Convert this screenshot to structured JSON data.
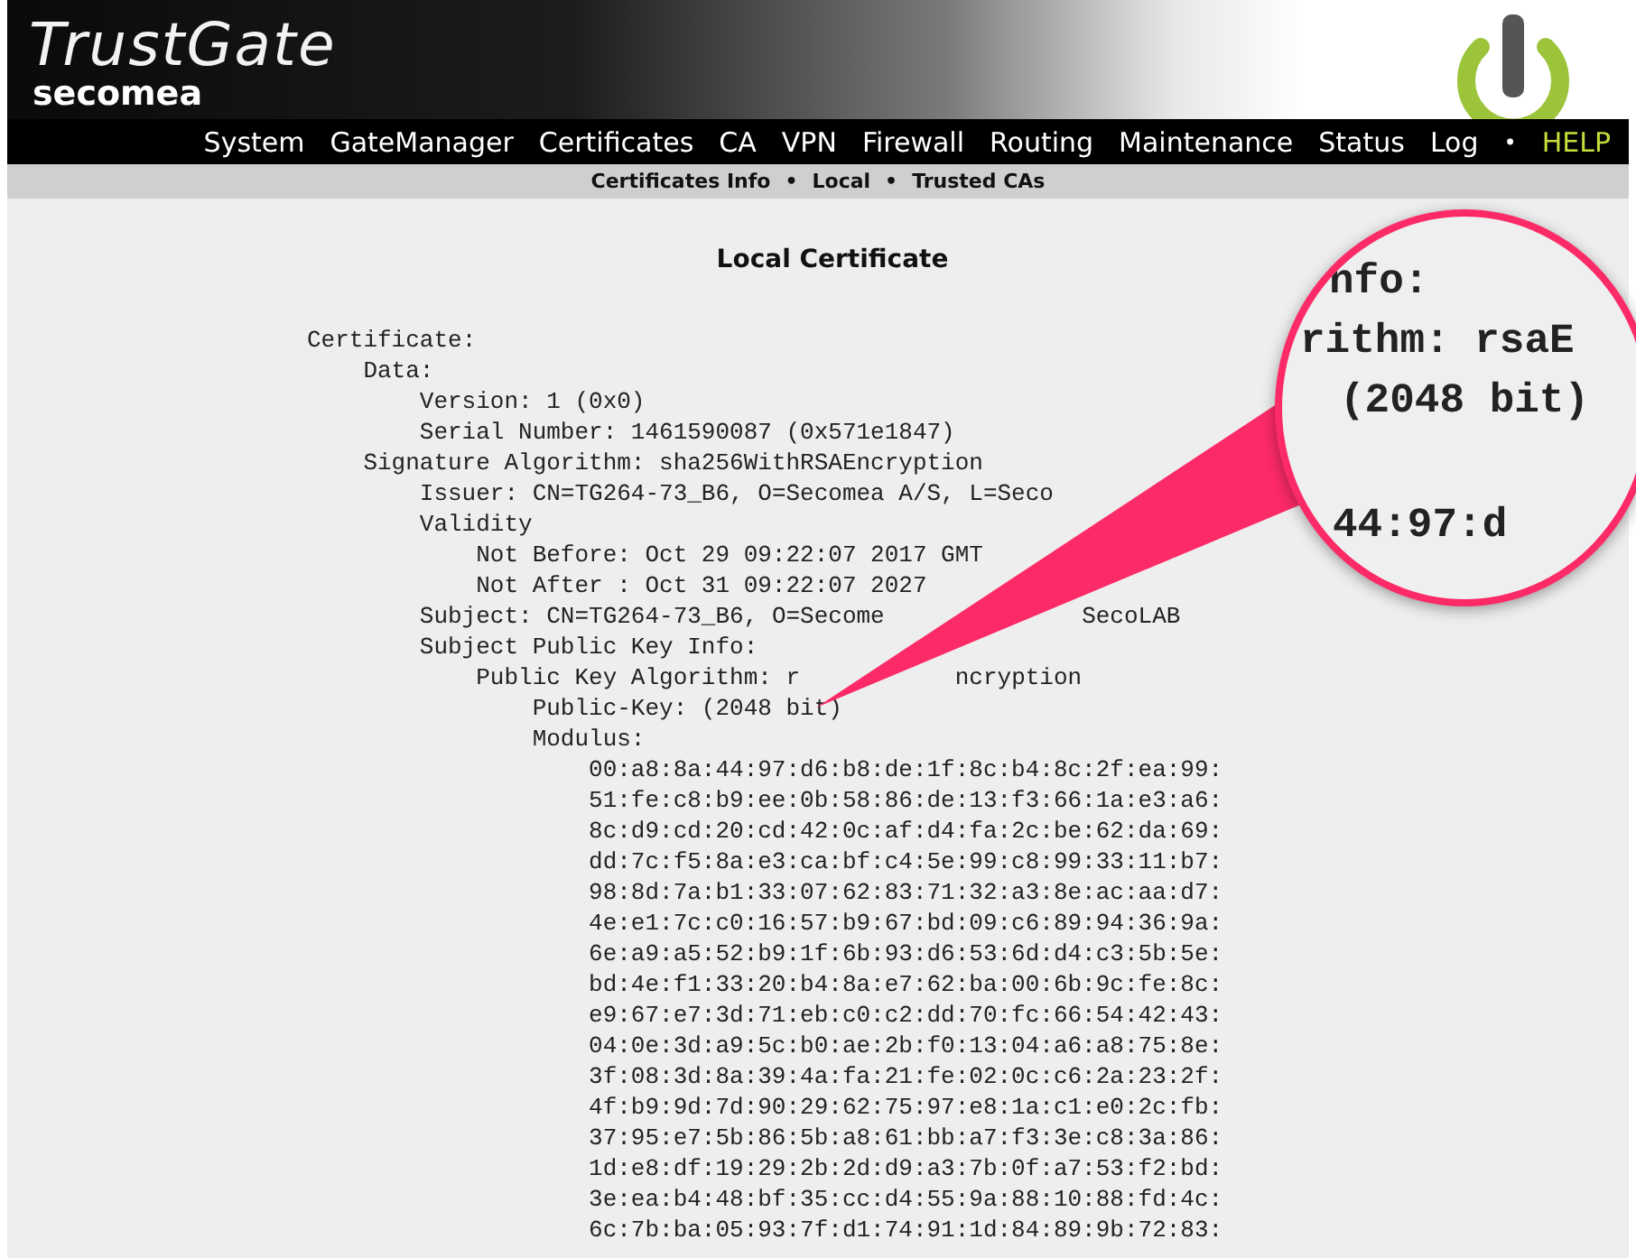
{
  "brand": {
    "title": "TrustGate",
    "company": "secomea"
  },
  "nav": [
    {
      "label": "System",
      "kind": "menu"
    },
    {
      "label": "GateManager",
      "kind": "menu"
    },
    {
      "label": "Certificates",
      "kind": "menu"
    },
    {
      "label": "CA",
      "kind": "menu"
    },
    {
      "label": "VPN",
      "kind": "menu"
    },
    {
      "label": "Firewall",
      "kind": "menu"
    },
    {
      "label": "Routing",
      "kind": "menu"
    },
    {
      "label": "Maintenance",
      "kind": "menu"
    },
    {
      "label": "Status",
      "kind": "menu"
    },
    {
      "label": "Log",
      "kind": "menu"
    },
    {
      "label": "•",
      "kind": "separator"
    },
    {
      "label": "HELP",
      "kind": "help"
    }
  ],
  "subnav": {
    "separator": "•",
    "items": [
      "Certificates Info",
      "Local",
      "Trusted CAs"
    ]
  },
  "page_title": "Local Certificate",
  "certificate": [
    {
      "text": "Certificate:",
      "children": [
        {
          "text": "Data:",
          "children": [
            {
              "text": "Version: 1 (0x0)"
            },
            {
              "text": "Serial Number: 1461590087 (0x571e1847)"
            }
          ]
        },
        {
          "text": "Signature Algorithm: sha256WithRSAEncryption",
          "children": [
            {
              "text": "Issuer: CN=TG264-73_B6, O=Secomea A/S, L=Seco"
            },
            {
              "text": "Validity",
              "children": [
                {
                  "text": "Not Before: Oct 29 09:22:07 2017 GMT"
                },
                {
                  "text": "Not After : Oct 31 09:22:07 2027"
                }
              ]
            },
            {
              "text": "Subject: CN=TG264-73_B6, O=Secome",
              "tail": "SecoLAB"
            },
            {
              "text": "Subject Public Key Info:",
              "children": [
                {
                  "text": "Public Key Algorithm: r",
                  "tail": "ncryption",
                  "children": [
                    {
                      "text": "Public-Key: (2048 bit)"
                    },
                    {
                      "text": "Modulus:",
                      "children": [
                        {
                          "text": "00:a8:8a:44:97:d6:b8:de:1f:8c:b4:8c:2f:ea:99:"
                        },
                        {
                          "text": "51:fe:c8:b9:ee:0b:58:86:de:13:f3:66:1a:e3:a6:"
                        },
                        {
                          "text": "8c:d9:cd:20:cd:42:0c:af:d4:fa:2c:be:62:da:69:"
                        },
                        {
                          "text": "dd:7c:f5:8a:e3:ca:bf:c4:5e:99:c8:99:33:11:b7:"
                        },
                        {
                          "text": "98:8d:7a:b1:33:07:62:83:71:32:a3:8e:ac:aa:d7:"
                        },
                        {
                          "text": "4e:e1:7c:c0:16:57:b9:67:bd:09:c6:89:94:36:9a:"
                        },
                        {
                          "text": "6e:a9:a5:52:b9:1f:6b:93:d6:53:6d:d4:c3:5b:5e:"
                        },
                        {
                          "text": "bd:4e:f1:33:20:b4:8a:e7:62:ba:00:6b:9c:fe:8c:"
                        },
                        {
                          "text": "e9:67:e7:3d:71:eb:c0:c2:dd:70:fc:66:54:42:43:"
                        },
                        {
                          "text": "04:0e:3d:a9:5c:b0:ae:2b:f0:13:04:a6:a8:75:8e:"
                        },
                        {
                          "text": "3f:08:3d:8a:39:4a:fa:21:fe:02:0c:c6:2a:23:2f:"
                        },
                        {
                          "text": "4f:b9:9d:7d:90:29:62:75:97:e8:1a:c1:e0:2c:fb:"
                        },
                        {
                          "text": "37:95:e7:5b:86:5b:a8:61:bb:a7:f3:3e:c8:3a:86:"
                        },
                        {
                          "text": "1d:e8:df:19:29:2b:2d:d9:a3:7b:0f:a7:53:f2:bd:"
                        },
                        {
                          "text": "3e:ea:b4:48:bf:35:cc:d4:55:9a:88:10:88:fd:4c:"
                        },
                        {
                          "text": "6c:7b:ba:05:93:7f:d1:74:91:1d:84:89:9b:72:83:"
                        }
                      ]
                    }
                  ]
                }
              ]
            }
          ]
        }
      ]
    }
  ],
  "magnifier": {
    "lines": [
      "nfo:",
      "rithm: rsaE",
      "(2048 bit)",
      "44:97:d"
    ]
  }
}
